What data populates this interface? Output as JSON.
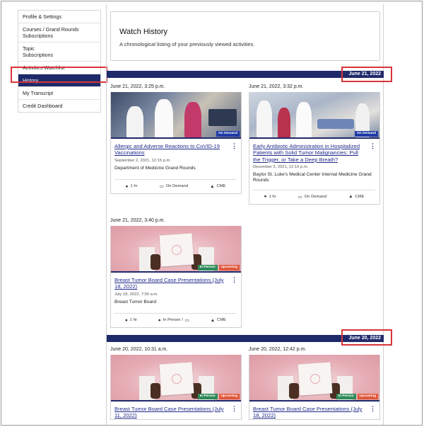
{
  "sidebar": {
    "items": [
      {
        "label": "Profile & Settings",
        "sub": ""
      },
      {
        "label": "Courses / Grand Rounds",
        "sub": "Subscriptions"
      },
      {
        "label": "Topic",
        "sub": "Subscriptions"
      },
      {
        "label": "Activities Watchlist",
        "sub": ""
      },
      {
        "label": "History",
        "sub": ""
      },
      {
        "label": "My Transcript",
        "sub": ""
      },
      {
        "label": "Credit Dashboard",
        "sub": ""
      }
    ],
    "active_index": 4
  },
  "header": {
    "title": "Watch History",
    "subtitle": "A chronological listing of your previously viewed activities."
  },
  "groups": [
    {
      "date_label": "June 21, 2022",
      "cards": [
        {
          "viewed": "June 21, 2022, 3:25 p.m.",
          "title": "Allergic and Adverse Reactions to CoVID-19 Vaccinations",
          "date": "September 2, 2021, 12:15 p.m.",
          "dept": "Department of Medicine Grand Rounds",
          "badges": [
            "On Demand"
          ],
          "duration": "1 hr",
          "format": "On Demand",
          "credit": "CME"
        },
        {
          "viewed": "June 21, 2022, 3:32 p.m.",
          "title": "Early Antibiotic Administration in Hospitalized Patients with Solid Tumor Malignancies: Pull the Trigger, or Take a Deep Breath?",
          "date": "December 3, 2021, 12:15 p.m.",
          "dept": "Baylor St. Luke's Medical Center Internal Medicine Grand Rounds",
          "badges": [
            "On Demand"
          ],
          "duration": "1 hr",
          "format": "On Demand",
          "credit": "CME"
        },
        {
          "viewed": "June 21, 2022, 3:40 p.m.",
          "title": "Breast Tumor Board Case Presentations (July 18, 2022)",
          "date": "July 18, 2022, 7:00 a.m.",
          "dept": "Breast Tumor Board",
          "badges": [
            "In Person",
            "Upcoming"
          ],
          "duration": "1 hr",
          "format": "In Person /",
          "credit": "CME"
        }
      ]
    },
    {
      "date_label": "June 20, 2022",
      "cards": [
        {
          "viewed": "June 20, 2022, 10:31 a.m.",
          "title": "Breast Tumor Board Case Presentations (July 11, 2022)",
          "badges": [
            "In Person",
            "Upcoming"
          ]
        },
        {
          "viewed": "June 20, 2022, 12:42 p.m.",
          "title": "Breast Tumor Board Case Presentations (July 18, 2022)",
          "badges": [
            "In Person",
            "Upcoming"
          ]
        }
      ]
    }
  ],
  "icons": {
    "kebab": "⋮",
    "clock": "●",
    "monitor": "▭",
    "cap": "▲",
    "person": "●"
  },
  "colors": {
    "navy": "#1f2a6b",
    "highlight": "#d8343a",
    "link": "#1f2a8a",
    "on_demand": "#1f3aa6",
    "in_person": "#2f8a5a",
    "upcoming": "#e0573b"
  }
}
